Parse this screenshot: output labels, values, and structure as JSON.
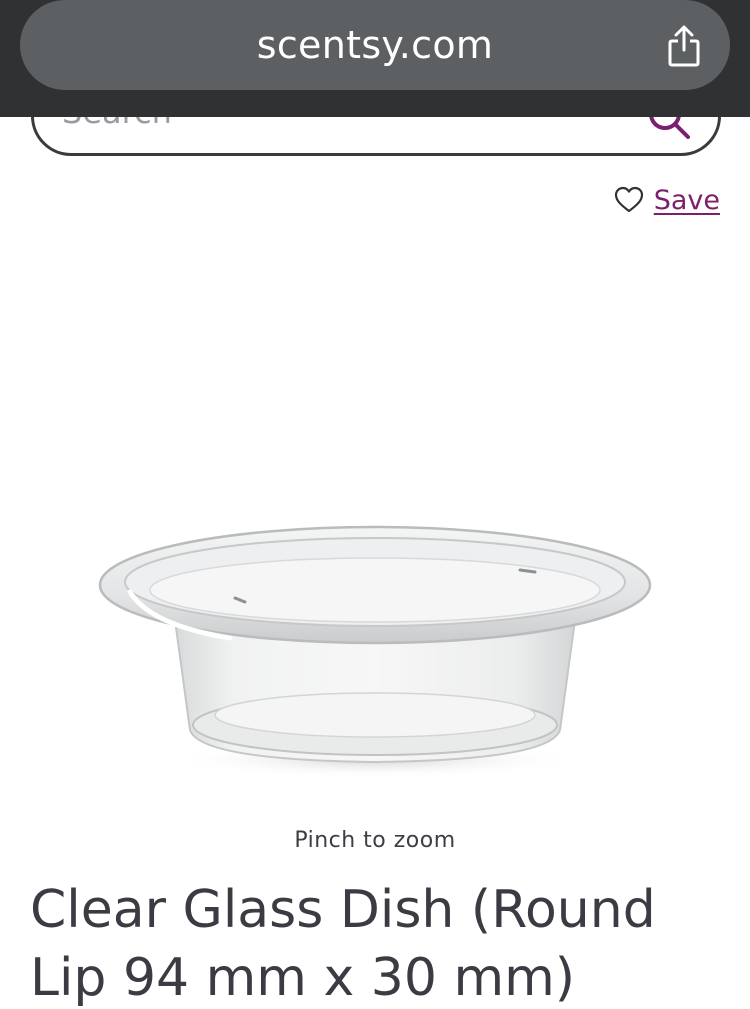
{
  "browser": {
    "url": "scentsy.com",
    "share_icon": "share-icon"
  },
  "search": {
    "placeholder": "Search",
    "icon": "search-icon"
  },
  "save": {
    "label": "Save",
    "icon": "heart-icon"
  },
  "product": {
    "image_alt": "Clear glass dish",
    "zoom_hint": "Pinch to zoom",
    "title": "Clear Glass Dish (Round Lip 94 mm x 30 mm)"
  },
  "colors": {
    "browser_bar": "#2f3133",
    "url_pill": "#5c6063",
    "accent": "#7c1f6e",
    "title_text": "#3c3a42"
  }
}
